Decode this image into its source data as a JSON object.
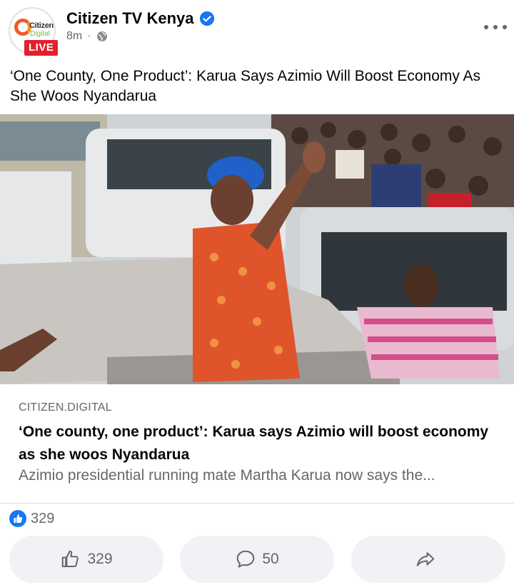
{
  "post": {
    "page_name": "Citizen TV Kenya",
    "time": "8m",
    "separator": "·",
    "text": "‘One County, One Product’: Karua Says Azimio Will Boost Economy As She Woos Nyandarua"
  },
  "avatar": {
    "line1": "Citizen",
    "line2": "Digital",
    "live_label": "LIVE"
  },
  "link_preview": {
    "domain": "CITIZEN.DIGITAL",
    "title": "‘One county, one product’: Karua says Azimio will boost economy as she woos Nyandarua",
    "description": "Azimio presidential running mate Martha Karua now says the..."
  },
  "reactions": {
    "count": "329"
  },
  "actions": {
    "like_count": "329",
    "comment_count": "50"
  },
  "colors": {
    "facebook_blue": "#1877f2",
    "live_red": "#e4202c",
    "secondary_text": "#65676b",
    "button_bg": "#f0f2f5"
  },
  "icons": [
    "verified-badge-icon",
    "globe-icon",
    "more-options-icon",
    "like-reaction-icon",
    "thumbs-up-icon",
    "comment-icon",
    "share-icon"
  ]
}
